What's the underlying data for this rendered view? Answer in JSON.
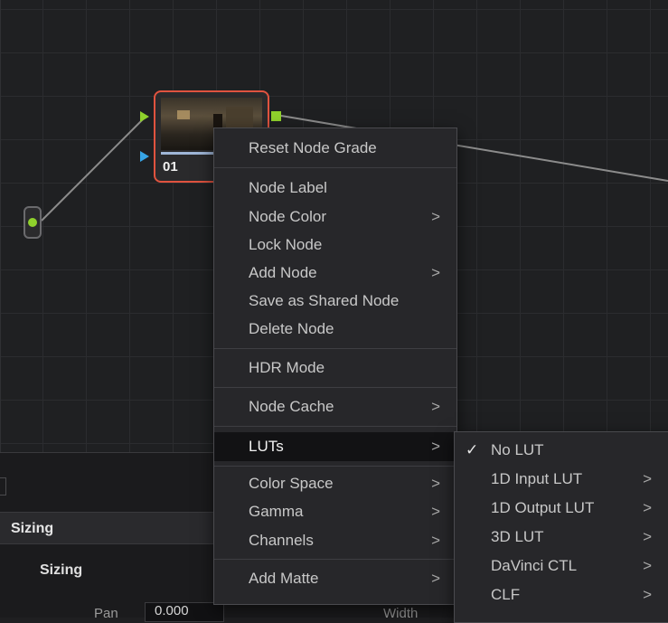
{
  "node": {
    "number": "01"
  },
  "context_menu": {
    "items": [
      {
        "label": "Reset Node Grade"
      },
      {
        "label": "Node Label"
      },
      {
        "label": "Node Color",
        "arrow": ">"
      },
      {
        "label": "Lock Node"
      },
      {
        "label": "Add Node",
        "arrow": ">"
      },
      {
        "label": "Save as Shared Node"
      },
      {
        "label": "Delete Node"
      },
      {
        "label": "HDR Mode"
      },
      {
        "label": "Node Cache",
        "arrow": ">"
      },
      {
        "label": "LUTs",
        "arrow": ">",
        "active": true
      },
      {
        "label": "Color Space",
        "arrow": ">"
      },
      {
        "label": "Gamma",
        "arrow": ">"
      },
      {
        "label": "Channels",
        "arrow": ">"
      },
      {
        "label": "Add Matte",
        "arrow": ">"
      }
    ]
  },
  "luts_submenu": {
    "check": "✓",
    "items": [
      {
        "label": "No LUT",
        "checked": true
      },
      {
        "label": "1D Input LUT",
        "arrow": ">"
      },
      {
        "label": "1D Output LUT",
        "arrow": ">"
      },
      {
        "label": "3D LUT",
        "arrow": ">"
      },
      {
        "label": "DaVinci CTL",
        "arrow": ">"
      },
      {
        "label": "CLF",
        "arrow": ">"
      }
    ]
  },
  "inspector": {
    "header": "Sizing",
    "section": "Sizing",
    "pan_label": "Pan",
    "pan_value": "0.000",
    "width_label": "Width"
  },
  "colors": {
    "node_border": "#e0533f",
    "rgb_port": "#8fd12c",
    "key_port": "#37a5e6"
  }
}
